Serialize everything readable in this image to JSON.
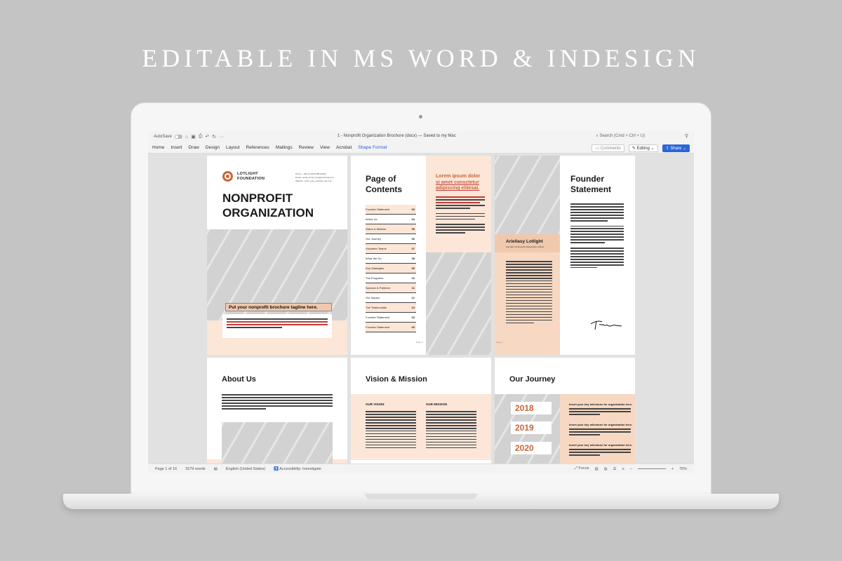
{
  "headline": "EDITABLE IN MS WORD & INDESIGN",
  "titlebar": {
    "autosave": "AutoSave",
    "doc_title": "1 - Nonprofit Organization Brochure (docx) — Saved to my Mac",
    "search": "Search (Cmd + Ctrl + U)"
  },
  "ribbon": {
    "tabs": [
      "Home",
      "Insert",
      "Draw",
      "Design",
      "Layout",
      "References",
      "Mailings",
      "Review",
      "View",
      "Acrobat",
      "Shape Format"
    ],
    "comments": "Comments",
    "editing": "Editing",
    "share": "Share"
  },
  "page1": {
    "logo_line1": "LOTLIGHT",
    "logo_line2": "FOUNDATION",
    "contact": [
      "Phone : +86 (1) 345 6789 10000",
      "Email : email_email_here@yourmail.com",
      "Website : www_your_website_site.com"
    ],
    "title_line1": "NONPROFIT",
    "title_line2": "ORGANIZATION",
    "tagline": "Put your nonprofit brochure tagline here."
  },
  "page2": {
    "title_line1": "Page of",
    "title_line2": "Contents",
    "toc": [
      {
        "label": "Founder Statement",
        "num": "03"
      },
      {
        "label": "About Us",
        "num": "04"
      },
      {
        "label": "Vision & Mission",
        "num": "05"
      },
      {
        "label": "Our Journey",
        "num": "06"
      },
      {
        "label": "Volunteer Teams",
        "num": "07"
      },
      {
        "label": "What We Do",
        "num": "08"
      },
      {
        "label": "Key Strategies",
        "num": "09"
      },
      {
        "label": "The Programs",
        "num": "10"
      },
      {
        "label": "Sponsor & Partners",
        "num": "11"
      },
      {
        "label": "Our Impact",
        "num": "12"
      },
      {
        "label": "The Testimonials",
        "num": "13"
      },
      {
        "label": "Founder Statement",
        "num": "03"
      },
      {
        "label": "Founder Statement",
        "num": "03"
      }
    ],
    "right_title_line1": "Lorem ipsum dolor",
    "right_title_line2": "si amet consctetur",
    "right_title_line3": "adipiscing elitesai.",
    "page_num": "Page 2"
  },
  "page3": {
    "name": "Ariellasy Lotlight",
    "role": "Founder of Nonprofit Organization Name",
    "title_line1": "Founder",
    "title_line2": "Statement",
    "page_num": "Page 3"
  },
  "page4": {
    "title": "About Us"
  },
  "page5": {
    "title": "Vision & Mission",
    "vision": "OUR VISION",
    "mission": "OUR MISSION"
  },
  "page6": {
    "title": "Our Journey",
    "milestones": [
      {
        "year": "2018",
        "title": "Insert your key milestone for organization here."
      },
      {
        "year": "2019",
        "title": "Insert your key milestone for organization here."
      },
      {
        "year": "2020",
        "title": "Insert your key milestone for organization here."
      }
    ]
  },
  "statusbar": {
    "page": "Page 1 of 16",
    "words": "3279 words",
    "language": "English (United States)",
    "accessibility": "Accessibility: Investigate",
    "focus": "Focus",
    "zoom": "75%"
  },
  "colors": {
    "accent": "#c8643a",
    "peach": "#fbe6d8",
    "share": "#2b66d9"
  }
}
